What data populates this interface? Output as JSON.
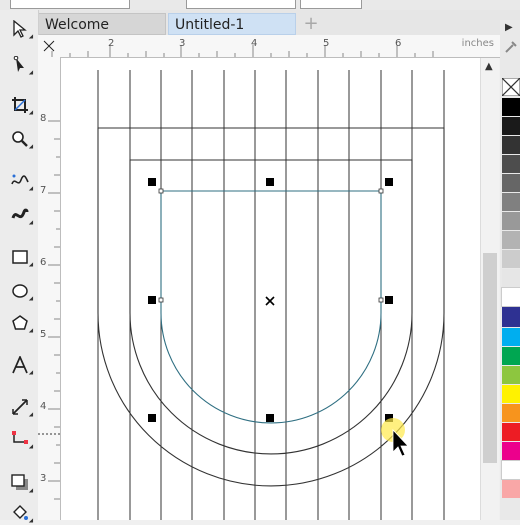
{
  "tabs": [
    {
      "label": "Welcome Screen"
    },
    {
      "label": "Untitled-1"
    }
  ],
  "add_tab_label": "+",
  "ruler": {
    "units": "inches",
    "h_labels": [
      "2",
      "3",
      "4",
      "5",
      "6"
    ],
    "v_labels": [
      "8",
      "7",
      "6",
      "5",
      "4",
      "3"
    ]
  },
  "tools": [
    "pick-tool-icon",
    "shape-tool-icon",
    "crop-tool-icon",
    "zoom-tool-icon",
    "freehand-tool-icon",
    "artistic-media-icon",
    "rectangle-tool-icon",
    "ellipse-tool-icon",
    "polygon-tool-icon",
    "text-tool-icon",
    "dimension-tool-icon",
    "connector-tool-icon",
    "drop-shadow-icon",
    "fill-tool-icon"
  ],
  "palette_colors": [
    "#000000",
    "#1a1a1a",
    "#333333",
    "#4d4d4d",
    "#666666",
    "#808080",
    "#999999",
    "#b3b3b3",
    "#cccccc",
    "#e6e6e6",
    "#ffffff",
    "#2e3192",
    "#00aeef",
    "#00a651",
    "#8dc63f",
    "#fff200",
    "#f7941d",
    "#ed1c24",
    "#ec008c",
    "#ffffff",
    "#f9a7a7"
  ]
}
